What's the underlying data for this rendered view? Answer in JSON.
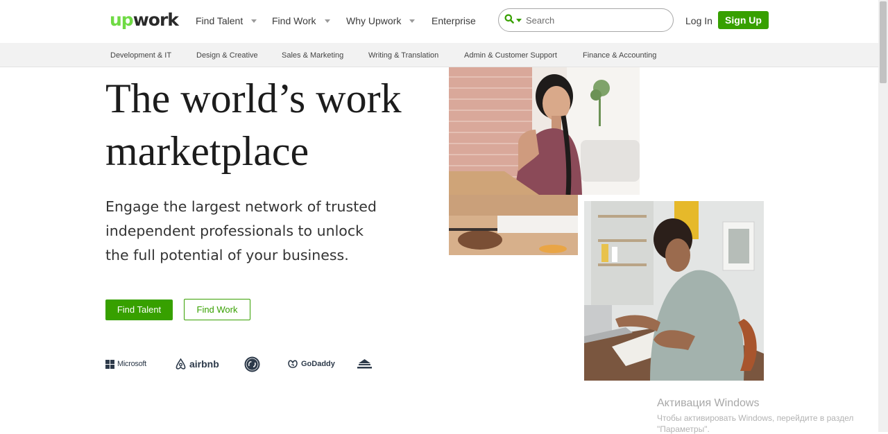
{
  "nav": {
    "logo_up": "up",
    "logo_work": "work",
    "find_talent": "Find Talent",
    "find_work": "Find Work",
    "why_upwork": "Why Upwork",
    "enterprise": "Enterprise",
    "login": "Log In",
    "signup": "Sign Up"
  },
  "search": {
    "placeholder": "Search"
  },
  "categories": [
    "Development & IT",
    "Design & Creative",
    "Sales & Marketing",
    "Writing & Translation",
    "Admin & Customer Support",
    "Finance & Accounting"
  ],
  "hero": {
    "title_line1": "The world’s work",
    "title_line2": "marketplace",
    "subtitle_line1": "Engage the largest network of trusted",
    "subtitle_line2": "independent professionals to unlock",
    "subtitle_line3": "the full potential of your business.",
    "btn_find_talent": "Find Talent",
    "btn_find_work": "Find Work"
  },
  "brands": {
    "microsoft": "Microsoft",
    "airbnb": "airbnb",
    "godaddy": "GoDaddy"
  },
  "watermark": {
    "title": "Активация Windows",
    "line1": "Чтобы активировать Windows, перейдите в раздел",
    "line2": "\"Параметры\"."
  },
  "colors": {
    "brand_green": "#37a000",
    "logo_green": "#6fda44"
  },
  "icons": {
    "search": "search-icon",
    "dropdown": "chevron-down-icon"
  }
}
